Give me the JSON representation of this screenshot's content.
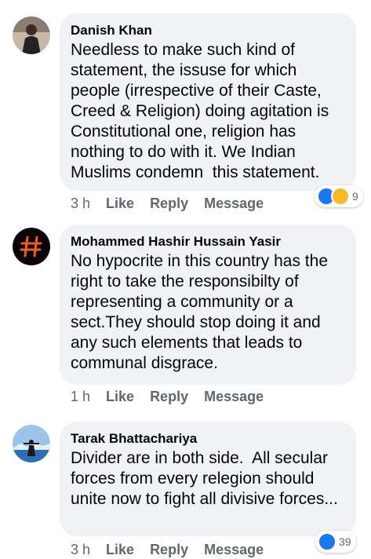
{
  "comments": [
    {
      "author": "Danish Khan",
      "text": "Needless to make such kind of statement, the issuse for which people (irrespective of their Caste, Creed & Religion) doing agitation is Constitutional one, religion has nothing to do with it. We Indian Muslims condemn  this statement.",
      "time": "3 h",
      "like": "Like",
      "reply": "Reply",
      "message": "Message",
      "reaction_count": "9",
      "reaction_icons": [
        "like-icon",
        "haha-icon"
      ]
    },
    {
      "author": "Mohammed Hashir Hussain Yasir",
      "text": "No hypocrite in this country has the right to take the responsibilty of representing a community or a sect.They should stop doing it and any such elements that leads to communal disgrace.",
      "time": "1 h",
      "like": "Like",
      "reply": "Reply",
      "message": "Message"
    },
    {
      "author": "Tarak Bhattachariya",
      "text": "Divider are in both side.  All secular forces from every relegion should unite now to fight all divisive forces...",
      "time": "3 h",
      "like": "Like",
      "reply": "Reply",
      "message": "Message",
      "reaction_count": "39",
      "reaction_icons": [
        "like-icon"
      ]
    }
  ],
  "colors": {
    "bubble": "#f0f2f5",
    "text": "#050505",
    "meta": "#606770",
    "like_blue": "#1877f2",
    "haha_yellow": "#f7b928"
  }
}
